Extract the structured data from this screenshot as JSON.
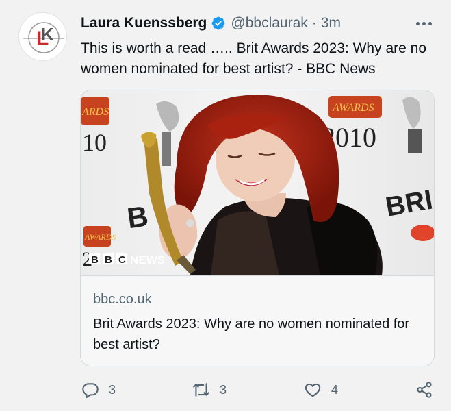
{
  "author": {
    "name": "Laura Kuenssberg",
    "handle": "@bbclaurak",
    "separator": "·",
    "time": "3m",
    "avatar_letter": "K",
    "avatar_letter_2": "L"
  },
  "tweet": {
    "text": "This is worth a read ….. Brit Awards 2023: Why are no women nominated for best artist? - BBC News"
  },
  "card": {
    "domain": "bbc.co.uk",
    "title": "Brit Awards 2023: Why are no women nominated for best artist?",
    "image_text": {
      "logo_letters": [
        "B",
        "B",
        "C"
      ],
      "logo_word": "NEWS",
      "board_left_top": "ARDS",
      "board_left_year": "10",
      "board_right_top": "AWARDS",
      "board_right_year": "2010",
      "board_right_bri": "BRI",
      "board_mid_b": "B",
      "board_left_low": "AWARDS",
      "board_left_low_year": "2"
    }
  },
  "actions": {
    "replies": "3",
    "retweets": "3",
    "likes": "4"
  },
  "colors": {
    "background": "#f2f2f2",
    "text": "#0f1419",
    "secondary": "#536471",
    "verified": "#1d9bf0",
    "border": "#cfd9de",
    "bbc_red": "#c52b2f"
  },
  "icons": {
    "verified": "verified-badge-icon",
    "more": "more-icon",
    "reply": "reply-icon",
    "retweet": "retweet-icon",
    "like": "like-icon",
    "share": "share-icon"
  }
}
